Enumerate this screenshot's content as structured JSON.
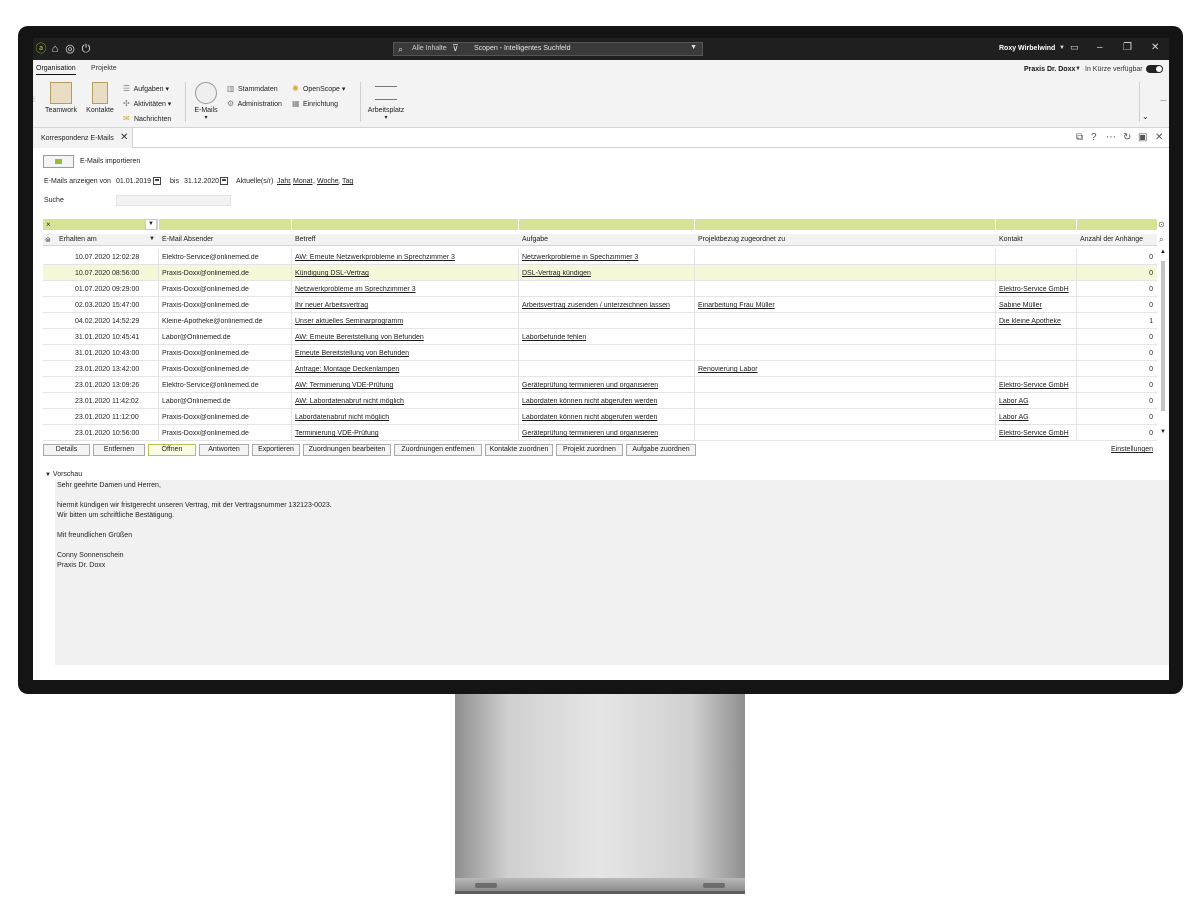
{
  "titlebar": {
    "search_scope": "Alle Inhalte",
    "search_text": "Scopen - Intelligentes Suchfeld",
    "user": "Roxy Wirbelwind"
  },
  "ribbon": {
    "tabs": [
      "Organisation",
      "Projekte"
    ],
    "practice": "Praxis Dr. Doxx",
    "coming_soon": "In Kürze verfügbar",
    "teamwork": "Teamwork",
    "kontakte": "Kontakte",
    "aufgaben": "Aufgaben",
    "aktivitaeten": "Aktivitäten",
    "nachrichten": "Nachrichten",
    "emails": "E-Mails",
    "stammdaten": "Stammdaten",
    "administration": "Administration",
    "openscope": "OpenScope",
    "einrichtung": "Einrichtung",
    "arbeitsplatz": "Arbeitsplatz"
  },
  "doc_tab": "Korrespondenz E-Mails",
  "filters": {
    "import_label": "E-Mails importieren",
    "show_from_label": "E-Mails anzeigen von",
    "from_date": "01.01.2019",
    "to_label": "bis",
    "to_date": "31.12.2020",
    "current_label": "Aktuelle(s/r)",
    "period_year": "Jahr",
    "period_month": "Monat",
    "period_week": "Woche",
    "period_day": "Tag",
    "search_label": "Suche"
  },
  "grid": {
    "columns": [
      "Erhalten am",
      "E-Mail Absender",
      "Betreff",
      "Aufgabe",
      "Projektbezug zugeordnet zu",
      "Kontakt",
      "Anzahl der Anhänge"
    ],
    "rows": [
      {
        "date": "10.07.2020 12:02:28",
        "sender": "Elektro-Service@onlinemed.de",
        "subject": "AW: Erneute Netzwerkprobleme in Sprechzimmer 3",
        "task": "Netzwerkprobleme in Spechzimmer 3",
        "project": "",
        "contact": "",
        "attachments": "0"
      },
      {
        "date": "10.07.2020 08:56:00",
        "sender": "Praxis-Doxx@onlinemed.de",
        "subject": "Kündigung DSL-Vertrag",
        "task": "DSL-Vertrag kündigen",
        "project": "",
        "contact": "",
        "attachments": "0"
      },
      {
        "date": "01.07.2020 09:29:00",
        "sender": "Praxis-Doxx@onlinemed.de",
        "subject": "Netzwerkprobleme im Sprechzimmer 3",
        "task": "",
        "project": "",
        "contact": "Elektro-Service GmbH",
        "attachments": "0"
      },
      {
        "date": "02.03.2020 15:47:00",
        "sender": "Praxis-Doxx@onlinemed.de",
        "subject": "Ihr neuer Arbeitsvertrag",
        "task": "Arbeitsvertrag zusenden / unterzeichnen lassen",
        "project": "Einarbeitung Frau Müller",
        "contact": "Sabine Müller",
        "attachments": "0"
      },
      {
        "date": "04.02.2020 14:52:29",
        "sender": "Kleine-Apotheke@onlinemed.de",
        "subject": "Unser aktuelles Seminarprogramm",
        "task": "",
        "project": "",
        "contact": "Die kleine Apotheke",
        "attachments": "1"
      },
      {
        "date": "31.01.2020 10:45:41",
        "sender": "Labor@Onlinemed.de",
        "subject": "AW: Erneute Bereitstellung von Befunden",
        "task": "Laborbefunde fehlen",
        "project": "",
        "contact": "",
        "attachments": "0"
      },
      {
        "date": "31.01.2020 10:43:00",
        "sender": "Praxis-Doxx@onlinemed.de",
        "subject": "Erneute Bereitstellung von Befunden",
        "task": "",
        "project": "",
        "contact": "",
        "attachments": "0"
      },
      {
        "date": "23.01.2020 13:42:00",
        "sender": "Praxis-Doxx@onlinemed.de",
        "subject": "Anfrage: Montage Deckenlampen",
        "task": "",
        "project": "Renovierung Labor",
        "contact": "",
        "attachments": "0"
      },
      {
        "date": "23.01.2020 13:09:26",
        "sender": "Elektro-Service@onlinemed.de",
        "subject": "AW: Terminierung VDE-Prüfung",
        "task": "Geräteprüfung terminieren und organisieren",
        "project": "",
        "contact": "Elektro-Service GmbH",
        "attachments": "0"
      },
      {
        "date": "23.01.2020 11:42:02",
        "sender": "Labor@Onlinemed.de",
        "subject": "AW: Labordatenabruf nicht möglich",
        "task": "Labordaten können nicht abgerufen werden",
        "project": "",
        "contact": "Labor AG",
        "attachments": "0"
      },
      {
        "date": "23.01.2020 11:12:00",
        "sender": "Praxis-Doxx@onlinemed.de",
        "subject": "Labordatenabruf nicht möglich",
        "task": "Labordaten können nicht abgerufen werden",
        "project": "",
        "contact": "Labor AG",
        "attachments": "0"
      },
      {
        "date": "23.01.2020 10:56:00",
        "sender": "Praxis-Doxx@onlinemed.de",
        "subject": "Terminierung VDE-Prüfung",
        "task": "Geräteprüfung terminieren und organisieren",
        "project": "",
        "contact": "Elektro-Service GmbH",
        "attachments": "0"
      }
    ]
  },
  "actions": [
    "Details",
    "Entfernen",
    "Öffnen",
    "Antworten",
    "Exportieren",
    "Zuordnungen bearbeiten",
    "Zuordnungen entfernen",
    "Kontakte zuordnen",
    "Projekt zuordnen",
    "Aufgabe zuordnen"
  ],
  "settings_link": "Einstellungen",
  "preview": {
    "title": "Vorschau",
    "lines": [
      "Sehr geehrte Damen und Herren,",
      "",
      "hiermit kündigen wir fristgerecht unseren Vertrag, mit der Vertragsnummer 132123-0023.",
      "Wir bitten um schriftliche Bestätigung.",
      "",
      "Mit freundlichen Grüßen",
      "",
      "Conny Sonnenschein",
      "Praxis Dr. Doxx"
    ]
  }
}
